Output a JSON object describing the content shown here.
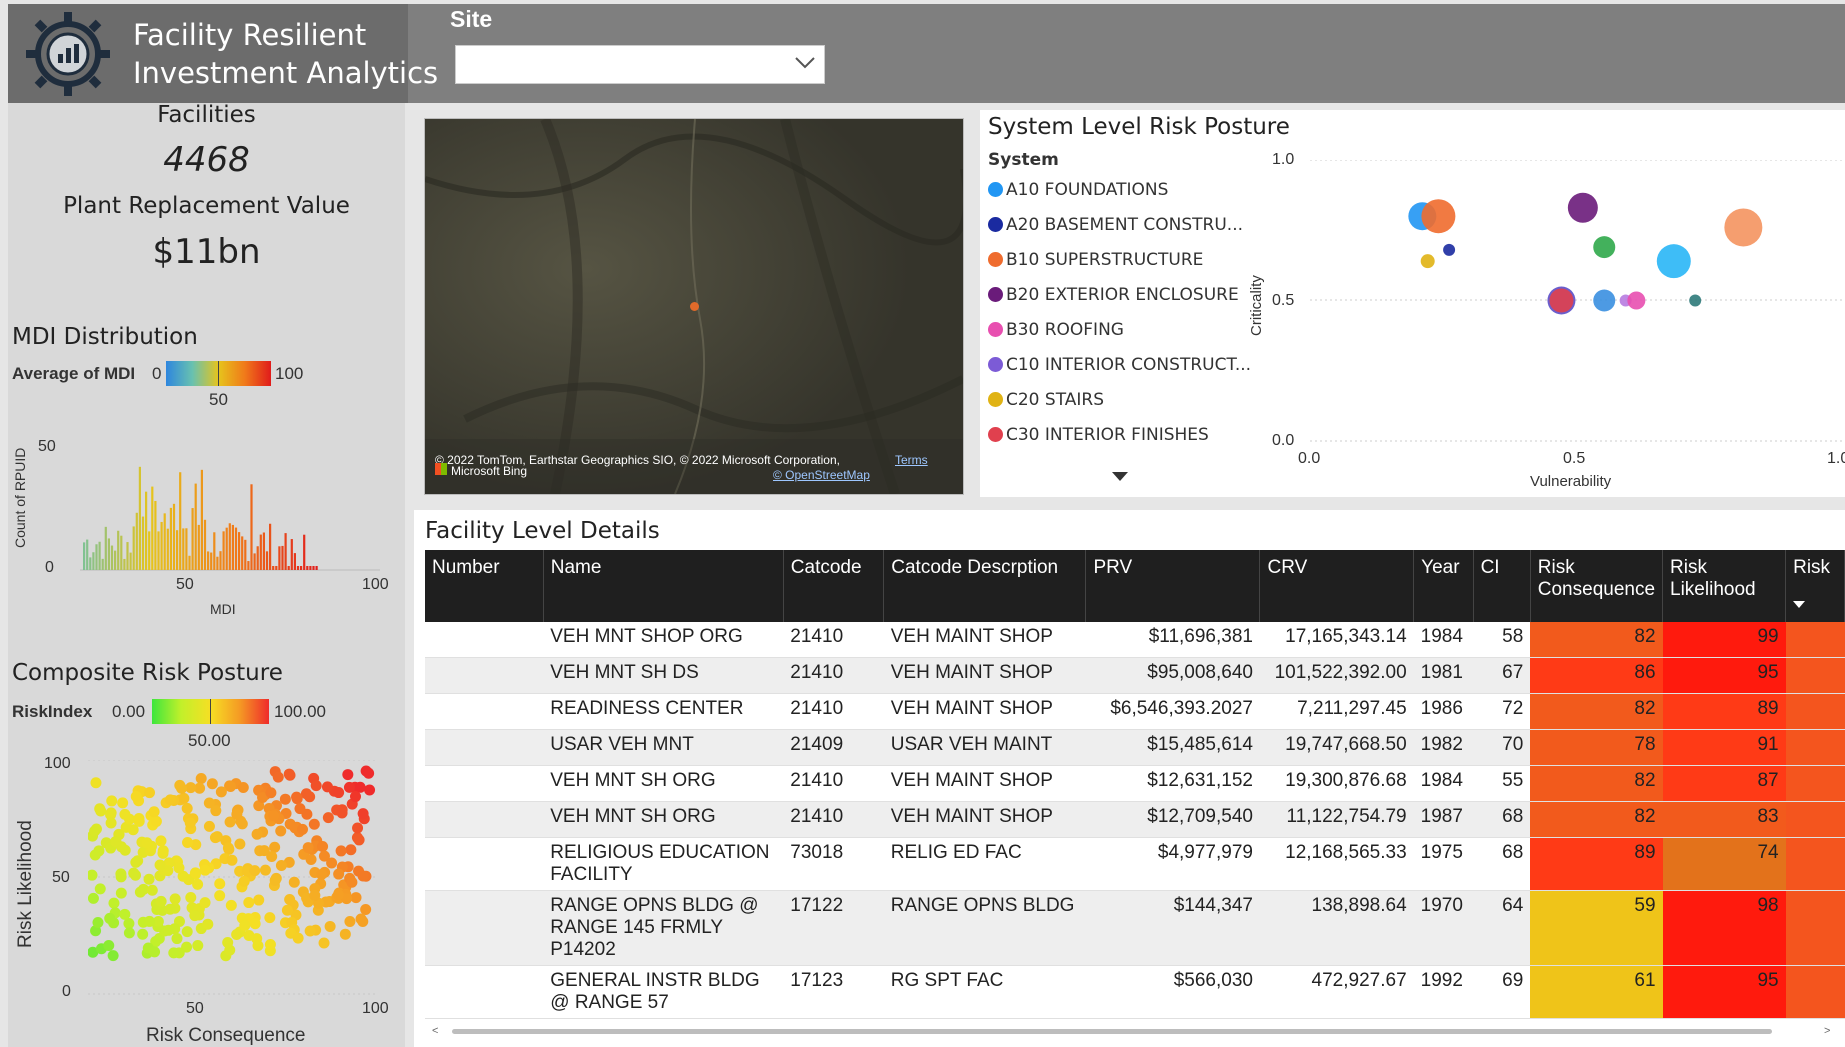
{
  "app": {
    "title_line1": "Facility Resilient",
    "title_line2": "Investment Analytics"
  },
  "site_filter": {
    "label": "Site",
    "value": ""
  },
  "kpis": {
    "facilities_label": "Facilities",
    "facilities_value": "4468",
    "prv_label": "Plant Replacement Value",
    "prv_value": "$11bn"
  },
  "mdi": {
    "title": "MDI Distribution",
    "legend_label": "Average of MDI",
    "legend_min": "0",
    "legend_max": "100",
    "legend_mid": "50",
    "ylabel": "Count of RPUID",
    "xlabel": "MDI",
    "yticks": [
      "50",
      "0"
    ],
    "xticks": [
      "50",
      "100"
    ]
  },
  "composite": {
    "title": "Composite Risk Posture",
    "legend_label": "RiskIndex",
    "legend_min": "0.00",
    "legend_max": "100.00",
    "legend_mid": "50.00",
    "ylabel": "Risk Likelihood",
    "xlabel": "Risk Consequence",
    "yticks": [
      "100",
      "50",
      "0"
    ],
    "xticks": [
      "50",
      "100"
    ]
  },
  "map": {
    "attribution": "© 2022 TomTom, Earthstar Geographics SIO, © 2022 Microsoft Corporation,",
    "terms": "Terms",
    "bing": "Microsoft Bing",
    "osm": "© OpenStreetMap"
  },
  "system_risk": {
    "title": "System Level Risk Posture",
    "legend_title": "System",
    "legend": [
      {
        "label": "A10 FOUNDATIONS",
        "color": "#2196f3"
      },
      {
        "label": "A20 BASEMENT CONSTRU...",
        "color": "#1a2aa0"
      },
      {
        "label": "B10 SUPERSTRUCTURE",
        "color": "#ef6c2e"
      },
      {
        "label": "B20 EXTERIOR ENCLOSURE",
        "color": "#6a1b7a"
      },
      {
        "label": "B30 ROOFING",
        "color": "#e84fb0"
      },
      {
        "label": "C10 INTERIOR CONSTRUCT...",
        "color": "#7c5bd6"
      },
      {
        "label": "C20 STAIRS",
        "color": "#e0b314"
      },
      {
        "label": "C30 INTERIOR FINISHES",
        "color": "#e0404e"
      }
    ],
    "xlabel": "Vulnerability",
    "ylabel": "Criticality",
    "yticks": [
      "1.0",
      "0.5",
      "0.0"
    ],
    "xticks": [
      "0.0",
      "0.5",
      "1.0"
    ]
  },
  "chart_data": {
    "type": "scatter",
    "title": "System Level Risk Posture",
    "xlabel": "Vulnerability",
    "ylabel": "Criticality",
    "xlim": [
      0,
      1
    ],
    "ylim": [
      0,
      1
    ],
    "points": [
      {
        "x": 0.21,
        "y": 0.8,
        "size": 14,
        "color": "#2196f3"
      },
      {
        "x": 0.24,
        "y": 0.8,
        "size": 17,
        "color": "#ef6c2e"
      },
      {
        "x": 0.26,
        "y": 0.68,
        "size": 6,
        "color": "#1a2aa0"
      },
      {
        "x": 0.22,
        "y": 0.64,
        "size": 7,
        "color": "#e0b314"
      },
      {
        "x": 0.51,
        "y": 0.83,
        "size": 15,
        "color": "#6a1b7a"
      },
      {
        "x": 0.55,
        "y": 0.69,
        "size": 11,
        "color": "#2fa84a"
      },
      {
        "x": 0.68,
        "y": 0.64,
        "size": 17,
        "color": "#29b6f6"
      },
      {
        "x": 0.81,
        "y": 0.76,
        "size": 19,
        "color": "#f4935f"
      },
      {
        "x": 0.47,
        "y": 0.5,
        "size": 14,
        "color": "#5a4cc8"
      },
      {
        "x": 0.47,
        "y": 0.5,
        "size": 12,
        "color": "#e0404e"
      },
      {
        "x": 0.55,
        "y": 0.5,
        "size": 11,
        "color": "#3a8fe0"
      },
      {
        "x": 0.59,
        "y": 0.5,
        "size": 6,
        "color": "#b77be0"
      },
      {
        "x": 0.61,
        "y": 0.5,
        "size": 9,
        "color": "#e84fb0"
      },
      {
        "x": 0.72,
        "y": 0.5,
        "size": 6,
        "color": "#2e7a7a"
      }
    ]
  },
  "facility_details": {
    "title": "Facility Level Details",
    "columns": [
      "Number",
      "Name",
      "Catcode",
      "Catcode Descrption",
      "PRV",
      "CRV",
      "Year",
      "CI",
      "Risk Consequence",
      "Risk Likelihood",
      "Risk"
    ],
    "rows": [
      {
        "number": "",
        "name": "VEH MNT SHOP ORG",
        "catcode": "21410",
        "desc": "VEH MAINT SHOP",
        "prv": "$11,696,381",
        "crv": "17,165,343.14",
        "year": "1984",
        "ci": "58",
        "rc": "82",
        "rl": "99"
      },
      {
        "number": "",
        "name": "VEH MNT SH DS",
        "catcode": "21410",
        "desc": "VEH MAINT SHOP",
        "prv": "$95,008,640",
        "crv": "101,522,392.00",
        "year": "1981",
        "ci": "67",
        "rc": "86",
        "rl": "95"
      },
      {
        "number": "",
        "name": "READINESS CENTER",
        "catcode": "21410",
        "desc": "VEH MAINT SHOP",
        "prv": "$6,546,393.2027",
        "crv": "7,211,297.45",
        "year": "1986",
        "ci": "72",
        "rc": "82",
        "rl": "89"
      },
      {
        "number": "",
        "name": "USAR VEH MNT",
        "catcode": "21409",
        "desc": "USAR VEH MAINT",
        "prv": "$15,485,614",
        "crv": "19,747,668.50",
        "year": "1982",
        "ci": "70",
        "rc": "78",
        "rl": "91"
      },
      {
        "number": "",
        "name": "VEH MNT SH ORG",
        "catcode": "21410",
        "desc": "VEH MAINT SHOP",
        "prv": "$12,631,152",
        "crv": "19,300,876.68",
        "year": "1984",
        "ci": "55",
        "rc": "82",
        "rl": "87"
      },
      {
        "number": "",
        "name": "VEH MNT SH ORG",
        "catcode": "21410",
        "desc": "VEH MAINT SHOP",
        "prv": "$12,709,540",
        "crv": "11,122,754.79",
        "year": "1987",
        "ci": "68",
        "rc": "82",
        "rl": "83"
      },
      {
        "number": "",
        "name": "RELIGIOUS EDUCATION FACILITY",
        "catcode": "73018",
        "desc": "RELIG ED FAC",
        "prv": "$4,977,979",
        "crv": "12,168,565.33",
        "year": "1975",
        "ci": "68",
        "rc": "89",
        "rl": "74"
      },
      {
        "number": "",
        "name": "RANGE OPNS BLDG @ RANGE 145 FRMLY P14202",
        "catcode": "17122",
        "desc": "RANGE OPNS BLDG",
        "prv": "$144,347",
        "crv": "138,898.64",
        "year": "1970",
        "ci": "64",
        "rc": "59",
        "rl": "98"
      },
      {
        "number": "",
        "name": "GENERAL INSTR BLDG @ RANGE 57",
        "catcode": "17123",
        "desc": "RG SPT FAC",
        "prv": "$566,030",
        "crv": "472,927.67",
        "year": "1992",
        "ci": "69",
        "rc": "61",
        "rl": "95"
      }
    ]
  },
  "colors": {
    "header_bg": "#7f7f7f",
    "panel_bg": "#d9d9d9",
    "table_header": "#1f1f1f"
  }
}
